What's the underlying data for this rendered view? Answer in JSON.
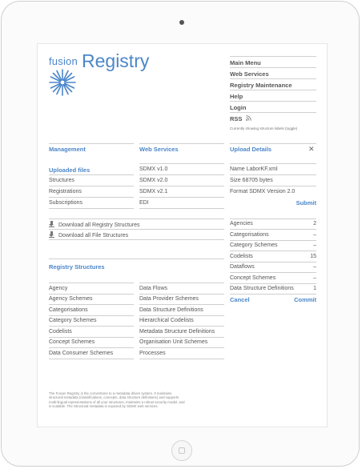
{
  "brand": {
    "small": "fusion",
    "big": "Registry"
  },
  "main_menu": [
    {
      "label": "Main Menu"
    },
    {
      "label": "Web Services"
    },
    {
      "label": "Registry Maintenance"
    },
    {
      "label": "Help"
    },
    {
      "label": "Login"
    },
    {
      "label": "RSS"
    }
  ],
  "menu_note": "Currently showing structure labels (toggle)",
  "management": {
    "title": "Management",
    "uploaded_title": "Uploaded files",
    "items": [
      {
        "label": "Structures"
      },
      {
        "label": "Registrations"
      },
      {
        "label": "Subscriptions"
      }
    ]
  },
  "web_services": {
    "title": "Web Services",
    "items": [
      {
        "label": "SDMX v1.0"
      },
      {
        "label": "SDMX v2.0"
      },
      {
        "label": "SDMX v2.1"
      },
      {
        "label": "EDI"
      }
    ]
  },
  "downloads": [
    {
      "label": "Download all Registry Structures"
    },
    {
      "label": "Download all File Structures"
    }
  ],
  "upload_details": {
    "title": "Upload Details",
    "close": "✕",
    "name": "Name LaborKF.xml",
    "size": "Size 68705 bytes",
    "format": "Format SDMX Version 2.0",
    "submit": "Submit",
    "counts": [
      {
        "label": "Agencies",
        "value": "2"
      },
      {
        "label": "Categorisations",
        "value": "–"
      },
      {
        "label": "Category Schemes",
        "value": "–"
      },
      {
        "label": "Codelists",
        "value": "15"
      },
      {
        "label": "Dataflows",
        "value": "–"
      },
      {
        "label": "Concept Schemes",
        "value": "–"
      },
      {
        "label": "Data Structure Definitions",
        "value": "1"
      }
    ],
    "cancel": "Cancel",
    "commit": "Commit"
  },
  "registry_structures": {
    "title": "Registry Structures",
    "col1": [
      {
        "label": "Agency"
      },
      {
        "label": "Agency Schemes"
      },
      {
        "label": "Categorisations"
      },
      {
        "label": "Category Schemes"
      },
      {
        "label": "Codelists"
      },
      {
        "label": "Concept Schemes"
      },
      {
        "label": "Data Consumer Schemes"
      }
    ],
    "col2": [
      {
        "label": "Data Flows"
      },
      {
        "label": "Data Provider Schemes"
      },
      {
        "label": "Data Structure Definitions"
      },
      {
        "label": "Hierarchical Codelists"
      },
      {
        "label": "Metadata Structure Definitions"
      },
      {
        "label": "Organisation Unit Schemes"
      },
      {
        "label": "Processes"
      }
    ]
  },
  "footer": "The Fusion Registry is the cornerstone to a metadata driven system. It maintains structural metadata (classifications, concepts, data structure definitions) and supports multi-lingual representations of all your structures, maintains a robust security model, and is scalable. The Structural metadata is exposed by SDMX web services.",
  "colors": {
    "accent": "#4b86c9",
    "text": "#555555",
    "rule": "#cfcfcf"
  }
}
